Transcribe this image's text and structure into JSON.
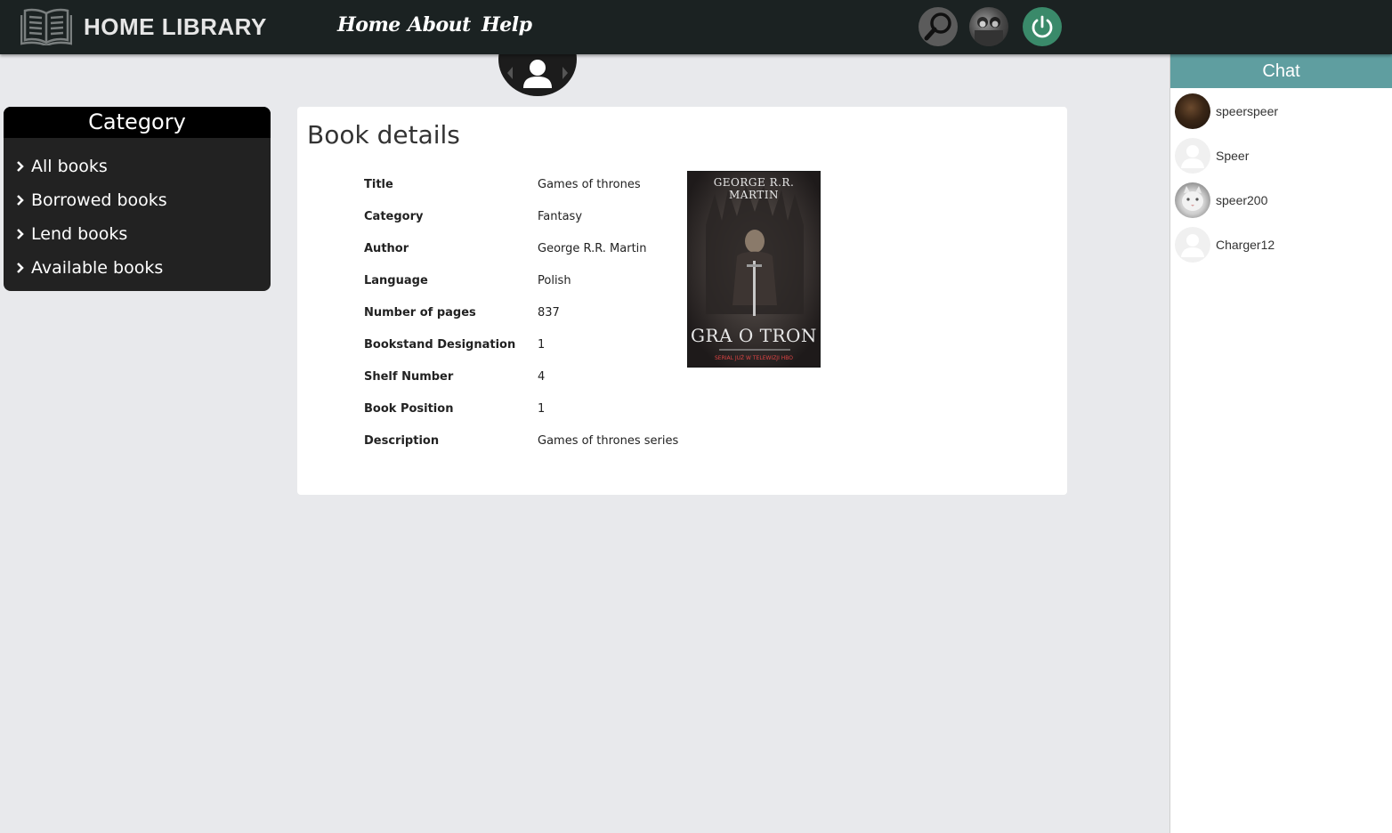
{
  "header": {
    "logo_text": "HOME LIBRARY",
    "nav": [
      {
        "label": "Home"
      },
      {
        "label": "About"
      },
      {
        "label": "Help"
      }
    ],
    "icons": [
      "search-icon",
      "user-avatar",
      "power-icon"
    ],
    "accent_power": "#3a8a6a"
  },
  "sidebar": {
    "title": "Category",
    "items": [
      {
        "label": "All books"
      },
      {
        "label": "Borrowed books"
      },
      {
        "label": "Lend books"
      },
      {
        "label": "Available books"
      }
    ]
  },
  "main": {
    "title": "Book details",
    "details": [
      {
        "label": "Title",
        "value": "Games of thrones"
      },
      {
        "label": "Category",
        "value": "Fantasy"
      },
      {
        "label": "Author",
        "value": "George R.R. Martin"
      },
      {
        "label": "Language",
        "value": "Polish"
      },
      {
        "label": "Number of pages",
        "value": "837"
      },
      {
        "label": "Bookstand Designation",
        "value": "1"
      },
      {
        "label": "Shelf Number",
        "value": "4"
      },
      {
        "label": "Book Position",
        "value": "1"
      },
      {
        "label": "Description",
        "value": "Games of thrones series"
      }
    ],
    "cover": {
      "author": "GEORGE R.R. MARTIN",
      "title": "GRA O TRON",
      "tagline": "SERIAL JUŻ W TELEWIZJI HBO"
    }
  },
  "chat": {
    "title": "Chat",
    "header_color": "#5f9ea0",
    "users": [
      {
        "name": "speerspeer",
        "avatar": "photo-dark"
      },
      {
        "name": "Speer",
        "avatar": "default"
      },
      {
        "name": "speer200",
        "avatar": "photo-cat"
      },
      {
        "name": "Charger12",
        "avatar": "default"
      }
    ]
  }
}
